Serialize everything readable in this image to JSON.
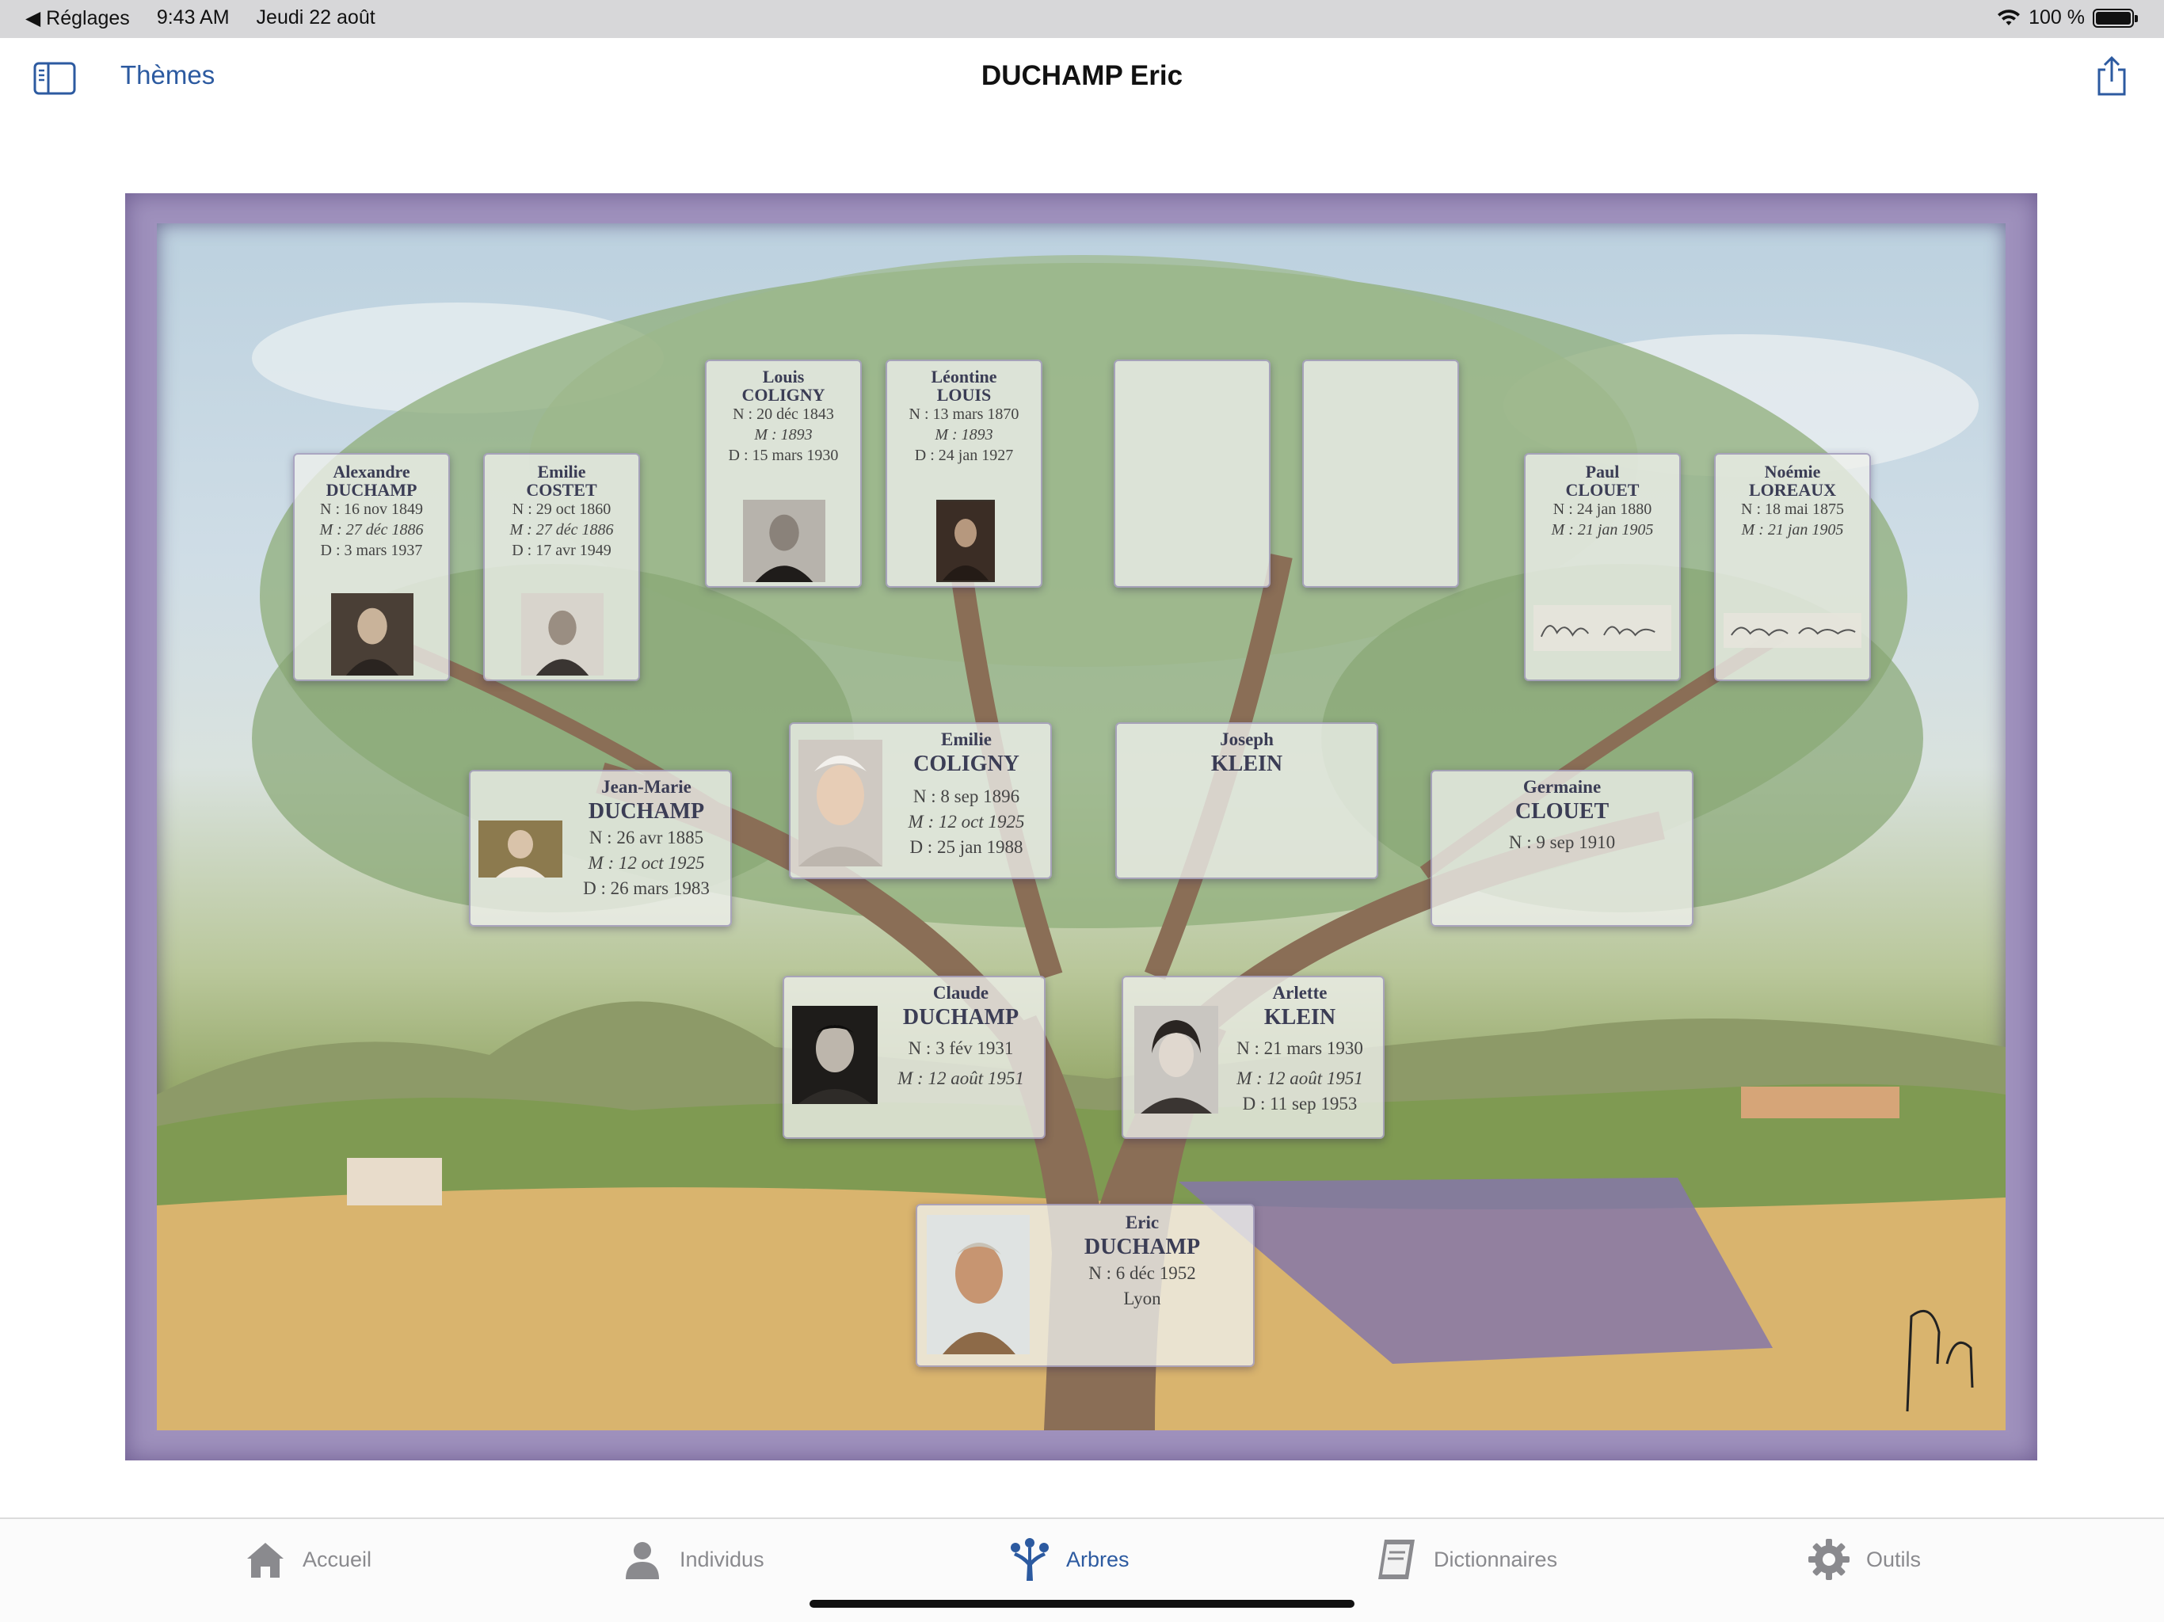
{
  "status_bar": {
    "back_label": "◀ Réglages",
    "time": "9:43 AM",
    "date": "Jeudi 22 août",
    "battery": "100 %"
  },
  "nav": {
    "themes_label": "Thèmes",
    "title": "DUCHAMP Eric"
  },
  "tree": {
    "great_grandparents": [
      {
        "first": "Alexandre",
        "last": "DUCHAMP",
        "birth": "N : 16 nov 1849",
        "marriage": "M : 27 déc 1886",
        "death": "D : 3 mars 1937"
      },
      {
        "first": "Emilie",
        "last": "COSTET",
        "birth": "N : 29 oct 1860",
        "marriage": "M : 27 déc 1886",
        "death": "D : 17 avr 1949"
      },
      {
        "first": "Louis",
        "last": "COLIGNY",
        "birth": "N : 20 déc 1843",
        "marriage": "M : 1893",
        "death": "D : 15 mars 1930"
      },
      {
        "first": "Léontine",
        "last": "LOUIS",
        "birth": "N : 13 mars 1870",
        "marriage": "M : 1893",
        "death": "D : 24 jan 1927"
      },
      {
        "first": "Paul",
        "last": "CLOUET",
        "birth": "N : 24 jan 1880",
        "marriage": "M : 21 jan 1905",
        "signature": "Clouet Paul"
      },
      {
        "first": "Noémie",
        "last": "LOREAUX",
        "birth": "N : 18 mai 1875",
        "marriage": "M : 21 jan 1905",
        "signature": "Noémie Loreaux"
      }
    ],
    "grandparents": [
      {
        "first": "Jean-Marie",
        "last": "DUCHAMP",
        "birth": "N : 26 avr 1885",
        "marriage": "M : 12 oct 1925",
        "death": "D : 26 mars 1983"
      },
      {
        "first": "Emilie",
        "last": "COLIGNY",
        "birth": "N : 8 sep 1896",
        "marriage": "M : 12 oct 1925",
        "death": "D : 25 jan 1988"
      },
      {
        "first": "Joseph",
        "last": "KLEIN"
      },
      {
        "first": "Germaine",
        "last": "CLOUET",
        "birth": "N : 9 sep 1910"
      }
    ],
    "parents": [
      {
        "first": "Claude",
        "last": "DUCHAMP",
        "birth": "N : 3 fév 1931",
        "marriage": "M : 12 août 1951"
      },
      {
        "first": "Arlette",
        "last": "KLEIN",
        "birth": "N : 21 mars 1930",
        "marriage": "M : 12 août 1951",
        "death": "D : 11 sep 1953"
      }
    ],
    "root": {
      "first": "Eric",
      "last": "DUCHAMP",
      "birth": "N : 6 déc 1952",
      "place": "Lyon"
    }
  },
  "tabs": [
    {
      "label": "Accueil",
      "icon": "house-icon"
    },
    {
      "label": "Individus",
      "icon": "person-icon"
    },
    {
      "label": "Arbres",
      "icon": "tree-icon"
    },
    {
      "label": "Dictionnaires",
      "icon": "book-icon"
    },
    {
      "label": "Outils",
      "icon": "gear-icon"
    }
  ],
  "colors": {
    "accent": "#2c5aa0",
    "frame": "#9f91bd",
    "tab_inactive": "#8a8a8e"
  }
}
